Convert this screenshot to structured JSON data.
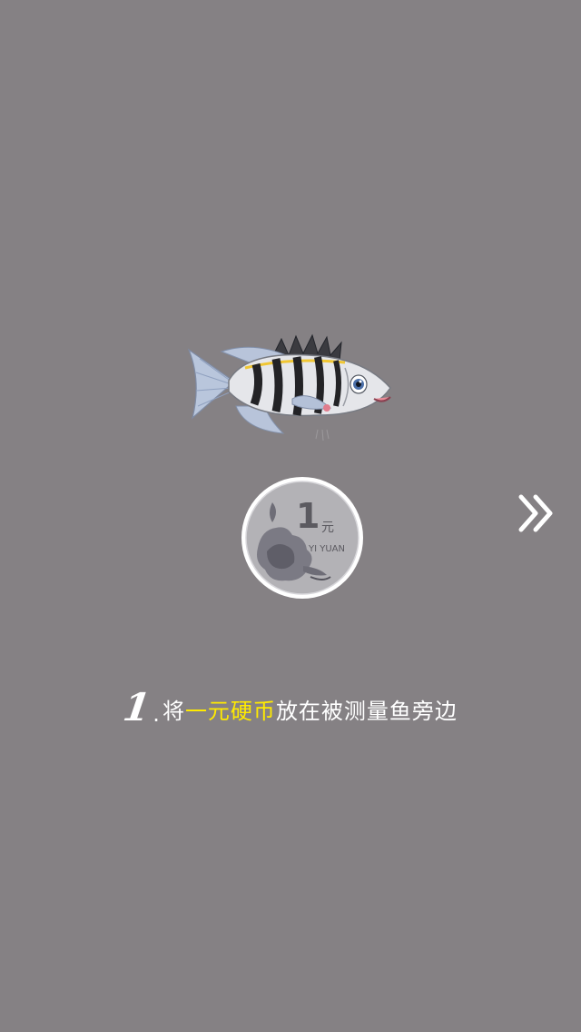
{
  "step": {
    "number": "1",
    "dot": ".",
    "text_before": "将",
    "text_highlight": "一元硬币",
    "text_after": "放在被测量鱼旁边"
  },
  "coin": {
    "value": "1",
    "unit": "元",
    "pinyin": "YI YUAN"
  },
  "icons": {
    "fish": "fish-illustration",
    "coin": "one-yuan-coin-icon",
    "next": "double-chevron-right-icon"
  },
  "colors": {
    "background": "#858184",
    "highlight": "#ffea00",
    "text": "#ffffff"
  }
}
